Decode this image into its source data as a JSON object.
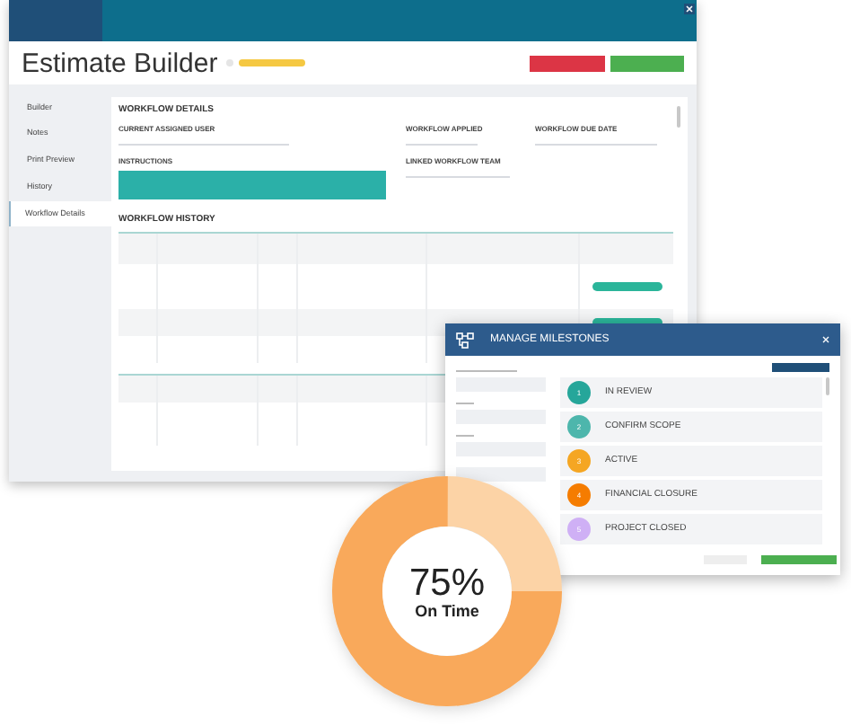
{
  "title": "Estimate Builder",
  "sidebar": [
    {
      "label": "Builder",
      "selected": false
    },
    {
      "label": "Notes",
      "selected": false
    },
    {
      "label": "Print Preview",
      "selected": false
    },
    {
      "label": "History",
      "selected": false
    },
    {
      "label": "Workflow Details",
      "selected": true
    }
  ],
  "workflow_details": {
    "heading": "WORKFLOW DETAILS",
    "current_assigned_user": "CURRENT ASSIGNED USER",
    "workflow_applied": "WORKFLOW APPLIED",
    "workflow_due_date": "WORKFLOW DUE DATE",
    "instructions": "INSTRUCTIONS",
    "linked_workflow_team": "LINKED WORKFLOW TEAM"
  },
  "workflow_history": {
    "heading": "WORKFLOW HISTORY"
  },
  "milestones_dialog": {
    "title": "MANAGE MILESTONES",
    "milestones": [
      {
        "number": "1",
        "label": "IN REVIEW",
        "color": "#26a69a"
      },
      {
        "number": "2",
        "label": "CONFIRM SCOPE",
        "color": "#4db6ac"
      },
      {
        "number": "3",
        "label": "ACTIVE",
        "color": "#f5a623"
      },
      {
        "number": "4",
        "label": "FINANCIAL CLOSURE",
        "color": "#f57c00"
      },
      {
        "number": "5",
        "label": "PROJECT CLOSED",
        "color": "#cfb0f5"
      }
    ]
  },
  "on_time": {
    "percent": "75%",
    "label": "On Time",
    "level": 0.75
  }
}
